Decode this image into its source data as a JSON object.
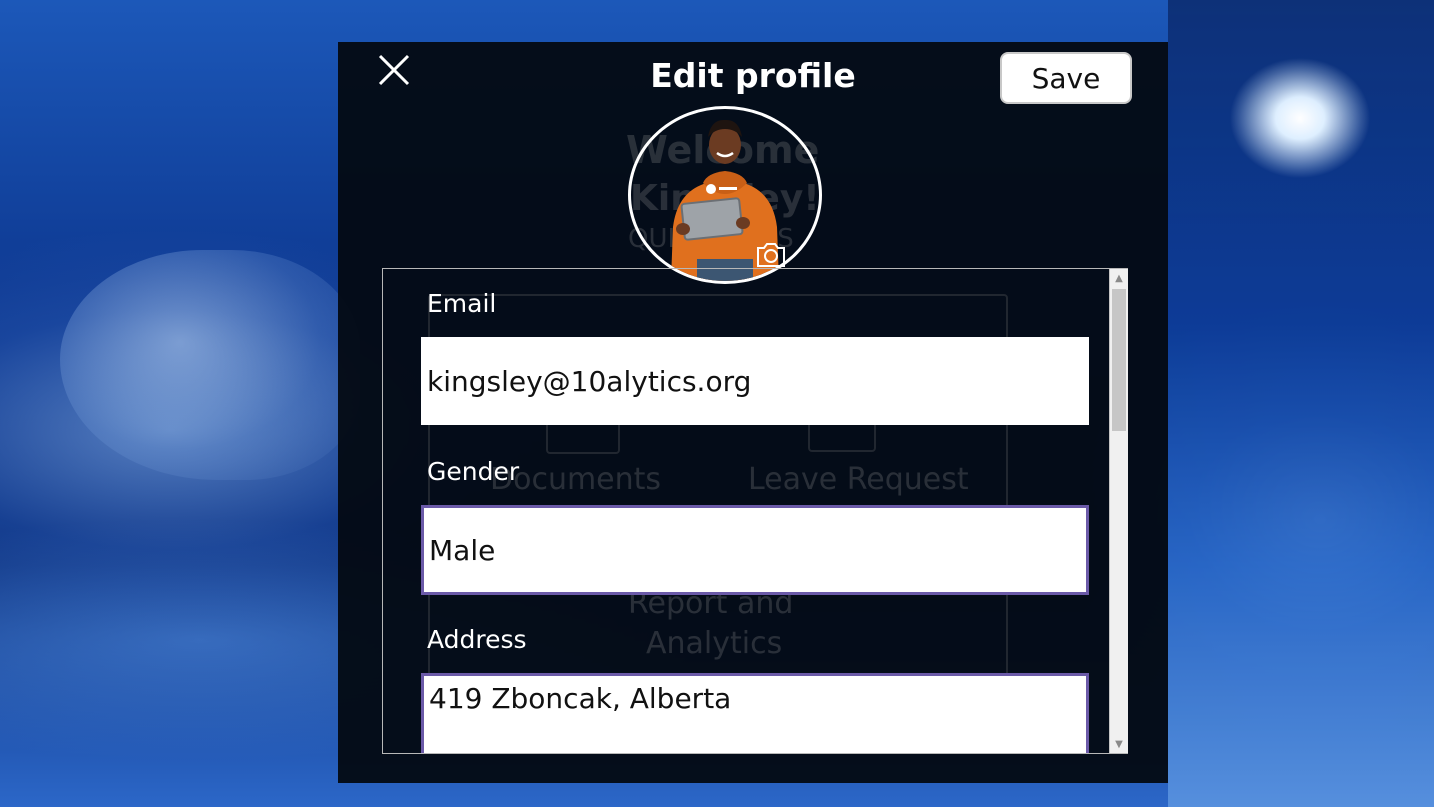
{
  "dialog": {
    "title": "Edit profile",
    "save_label": "Save",
    "close_icon": "close-icon",
    "camera_icon": "camera-icon"
  },
  "background_screen": {
    "welcome_line1": "Welcome",
    "welcome_line2": "Kingsley!",
    "welcome_line3": "QUICK LINKS",
    "tile_documents": "Documents",
    "tile_leave_request": "Leave Request",
    "tile_report_line1": "Report and",
    "tile_report_line2": "Analytics"
  },
  "form": {
    "email_label": "Email",
    "email_value": "kingsley@10alytics.org",
    "gender_label": "Gender",
    "gender_value": "Male",
    "address_label": "Address",
    "address_value": "419 Zboncak, Alberta"
  },
  "colors": {
    "dialog_bg": "#040a14",
    "field_border_focus": "#6b5aa8",
    "accent_hoodie": "#e0701e"
  }
}
